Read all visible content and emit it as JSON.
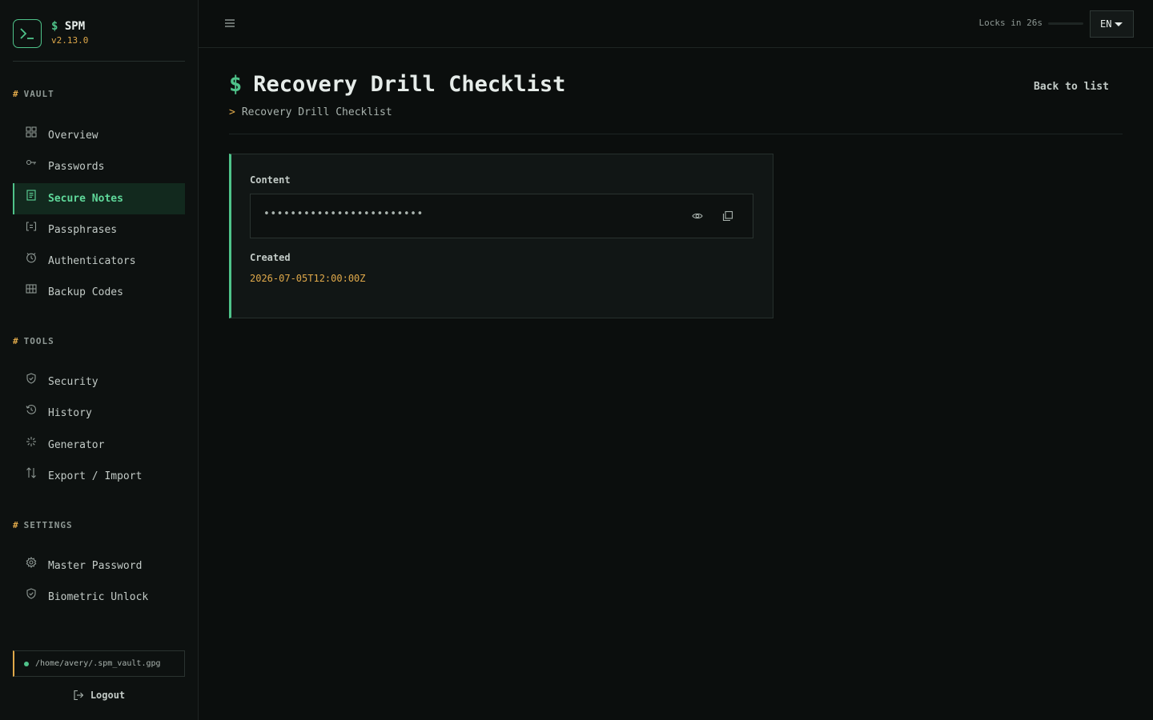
{
  "brand": {
    "prefix": "$",
    "name": "SPM",
    "version": "v2.13.0"
  },
  "sidebar": {
    "sections": [
      {
        "title": "VAULT",
        "items": [
          {
            "label": "Overview",
            "icon": "grid-icon"
          },
          {
            "label": "Passwords",
            "icon": "key-icon"
          },
          {
            "label": "Secure Notes",
            "icon": "note-icon",
            "active": true
          },
          {
            "label": "Passphrases",
            "icon": "bracket-icon"
          },
          {
            "label": "Authenticators",
            "icon": "clock-icon"
          },
          {
            "label": "Backup Codes",
            "icon": "table-icon"
          }
        ]
      },
      {
        "title": "TOOLS",
        "items": [
          {
            "label": "Security",
            "icon": "shield-icon"
          },
          {
            "label": "History",
            "icon": "history-icon"
          },
          {
            "label": "Generator",
            "icon": "sparkle-icon"
          },
          {
            "label": "Export / Import",
            "icon": "arrows-icon"
          }
        ]
      },
      {
        "title": "SETTINGS",
        "items": [
          {
            "label": "Master Password",
            "icon": "gear-icon"
          },
          {
            "label": "Biometric Unlock",
            "icon": "shield-icon"
          }
        ]
      }
    ],
    "vault_path": "/home/avery/.spm_vault.gpg",
    "logout_label": "Logout"
  },
  "topbar": {
    "locks_text": "Locks in 26s",
    "lock_progress": 0.0,
    "language": "EN"
  },
  "page": {
    "title_prefix": "$",
    "title": "Recovery Drill Checklist",
    "breadcrumb_prefix": ">",
    "breadcrumb": "Recovery Drill Checklist",
    "back_label": "Back to list"
  },
  "note": {
    "content_label": "Content",
    "content_masked": "••••••••••••••••••••••••",
    "created_label": "Created",
    "created_value": "2026-07-05T12:00:00Z"
  },
  "colors": {
    "accent": "#4fc38a",
    "warning": "#e0a94a",
    "background": "#0b0e0d"
  }
}
